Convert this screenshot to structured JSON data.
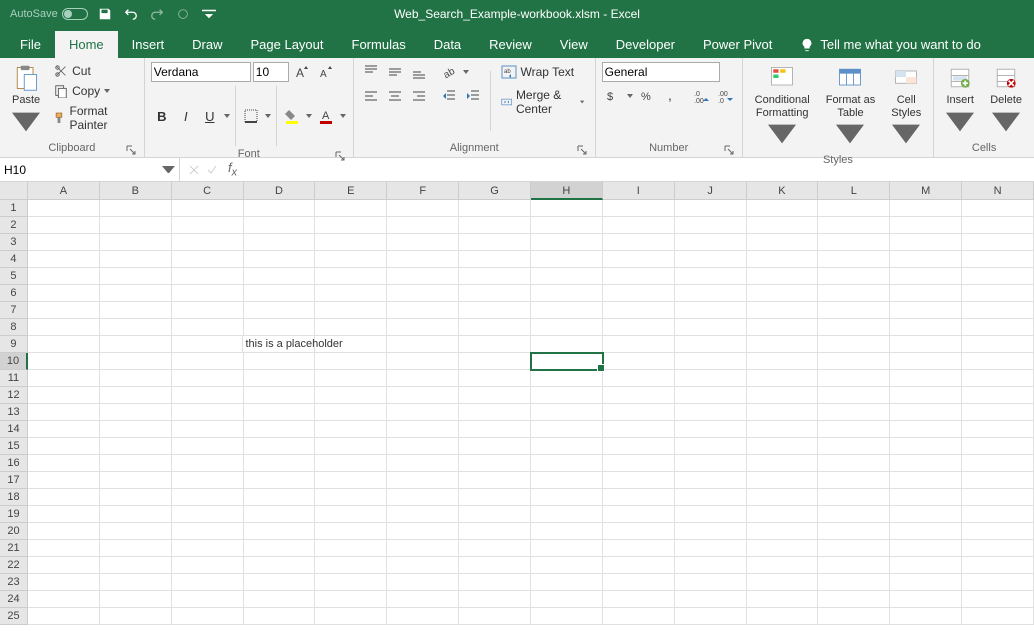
{
  "titlebar": {
    "autosave_label": "AutoSave",
    "autosave_state": "Off",
    "title": "Web_Search_Example-workbook.xlsm  -  Excel"
  },
  "tabs": {
    "file": "File",
    "home": "Home",
    "insert": "Insert",
    "draw": "Draw",
    "page_layout": "Page Layout",
    "formulas": "Formulas",
    "data": "Data",
    "review": "Review",
    "view": "View",
    "developer": "Developer",
    "power_pivot": "Power Pivot",
    "tell_me": "Tell me what you want to do"
  },
  "ribbon": {
    "clipboard": {
      "paste": "Paste",
      "cut": "Cut",
      "copy": "Copy",
      "format_painter": "Format Painter",
      "label": "Clipboard"
    },
    "font": {
      "name": "Verdana",
      "size": "10",
      "label": "Font"
    },
    "alignment": {
      "wrap": "Wrap Text",
      "merge": "Merge & Center",
      "label": "Alignment"
    },
    "number": {
      "format": "General",
      "label": "Number"
    },
    "styles": {
      "conditional": "Conditional\nFormatting",
      "table": "Format as\nTable",
      "cell": "Cell\nStyles",
      "label": "Styles"
    },
    "cells": {
      "insert": "Insert",
      "delete": "Delete",
      "label": "Cells"
    }
  },
  "namebox": {
    "ref": "H10"
  },
  "formula_bar": {
    "value": ""
  },
  "sheet": {
    "columns": [
      "A",
      "B",
      "C",
      "D",
      "E",
      "F",
      "G",
      "H",
      "I",
      "J",
      "K",
      "L",
      "M",
      "N"
    ],
    "rows": 25,
    "active_col": "H",
    "active_row": 10,
    "cells": {
      "D9": "this is a placeholder"
    }
  }
}
